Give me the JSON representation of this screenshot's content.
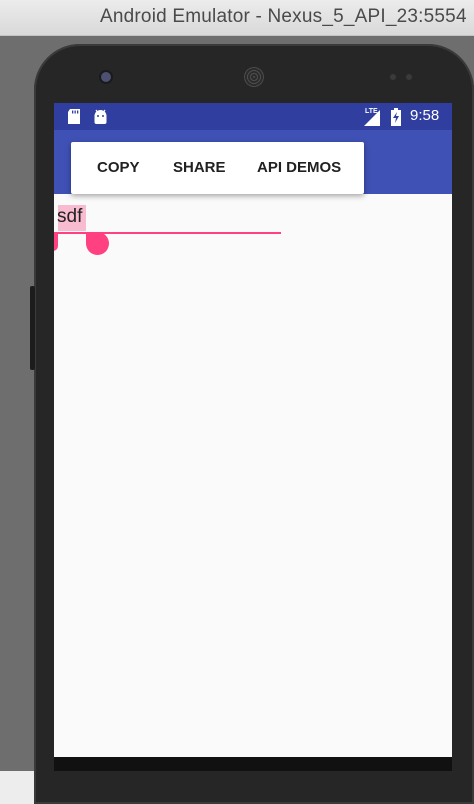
{
  "window": {
    "title": "Android Emulator - Nexus_5_API_23:5554"
  },
  "status_bar": {
    "time": "9:58",
    "network": "LTE",
    "left_icons": [
      "sd-card-icon",
      "android-icon"
    ],
    "right_icons": [
      "signal-icon",
      "battery-charging-icon"
    ]
  },
  "text_selection_menu": {
    "items": [
      {
        "label": "COPY"
      },
      {
        "label": "SHARE"
      },
      {
        "label": "API DEMOS"
      }
    ]
  },
  "edit_text": {
    "value": "sdf",
    "selected_text": "sdf"
  },
  "colors": {
    "status_bar": "#303f9f",
    "app_bar": "#3f51b5",
    "accent": "#ff4081",
    "selection": "#f8bbd0",
    "screen_background": "#fafafa"
  }
}
